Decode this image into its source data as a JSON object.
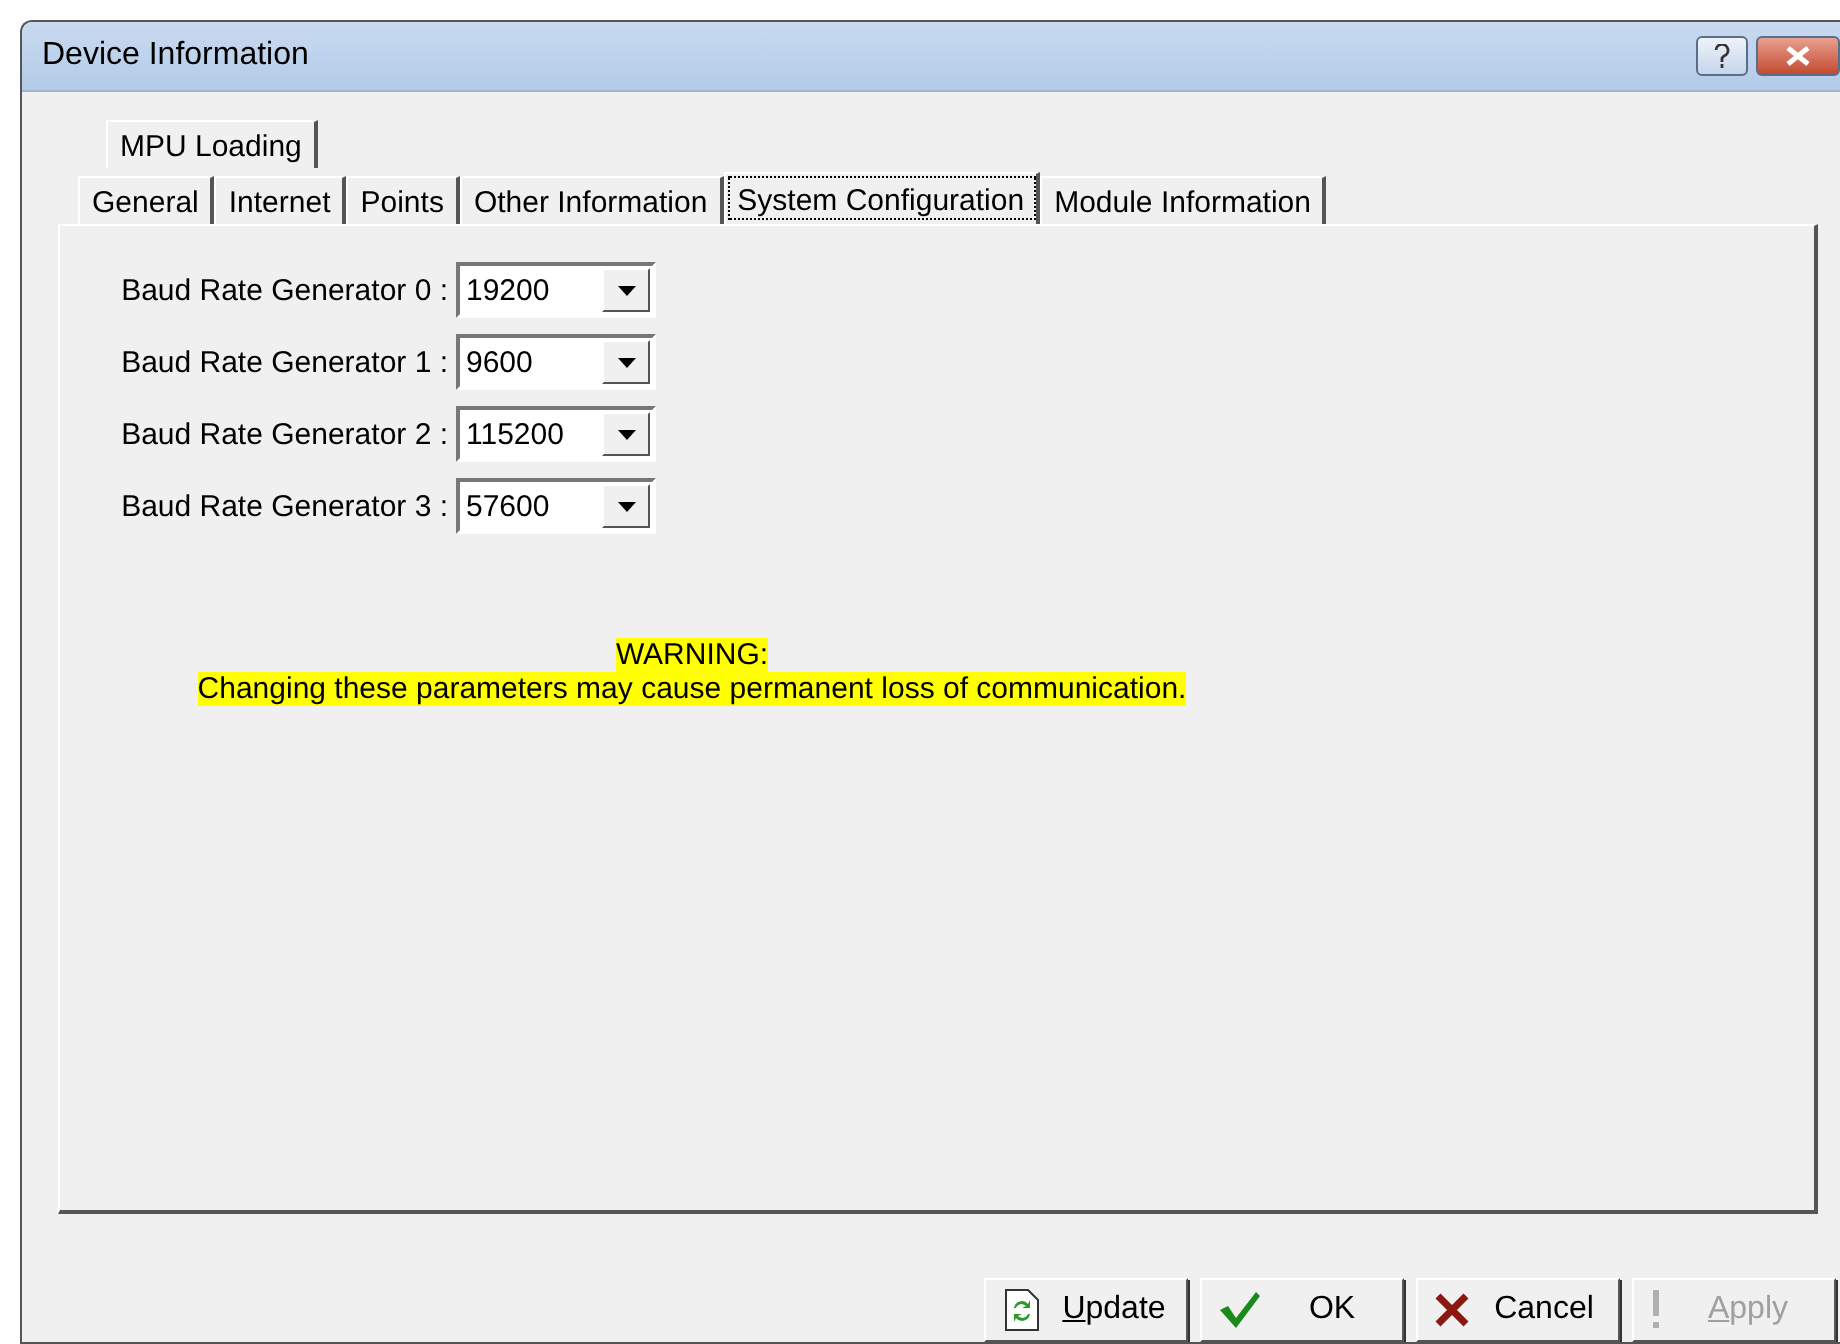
{
  "window": {
    "title": "Device Information"
  },
  "tab_rows": [
    [
      {
        "label": "MPU Loading",
        "selected": false
      }
    ],
    [
      {
        "label": "General",
        "selected": false
      },
      {
        "label": "Internet",
        "selected": false
      },
      {
        "label": "Points",
        "selected": false
      },
      {
        "label": "Other Information",
        "selected": false
      },
      {
        "label": "System Configuration",
        "selected": true
      },
      {
        "label": "Module Information",
        "selected": false
      }
    ]
  ],
  "fields": [
    {
      "label": "Baud Rate Generator 0 :",
      "value": "19200"
    },
    {
      "label": "Baud Rate Generator 1 :",
      "value": "9600"
    },
    {
      "label": "Baud Rate Generator 2 :",
      "value": "115200"
    },
    {
      "label": "Baud Rate Generator 3 :",
      "value": "57600"
    }
  ],
  "warning": {
    "title": "WARNING:",
    "text": "Changing these parameters may cause permanent loss of communication."
  },
  "buttons": [
    {
      "label": "Update",
      "kind": "update",
      "disabled": false
    },
    {
      "label": "OK",
      "kind": "ok",
      "disabled": false
    },
    {
      "label": "Cancel",
      "kind": "cancel",
      "disabled": false
    },
    {
      "label": "Apply",
      "kind": "apply",
      "disabled": true
    }
  ]
}
